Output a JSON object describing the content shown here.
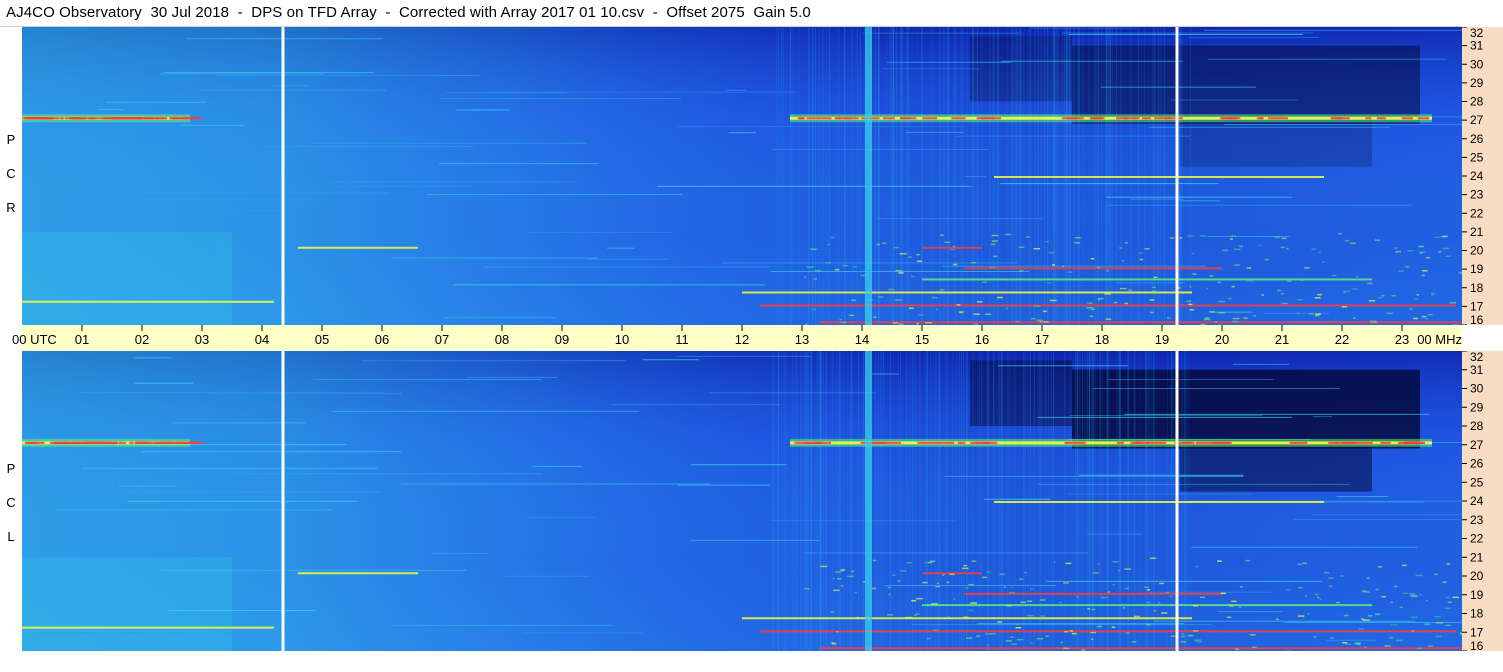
{
  "title": "AJ4CO Observatory  30 Jul 2018  -  DPS on TFD Array  -  Corrected with Array 2017 01 10.csv  -  Offset 2075  Gain 5.0",
  "colors": {
    "axis_band": "#ffffc8",
    "freq_band": "#f9dcc4",
    "deep_blue": "#0c1fa8",
    "mid_blue": "#1e55e0",
    "light_blue": "#2fa0f0",
    "cyan": "#38d0ec",
    "dark": "#050a40",
    "hot_red": "#ff3b3b",
    "hot_yellow": "#f4ff3a",
    "hot_green": "#58f080"
  },
  "chart_data": {
    "type": "heatmap",
    "x_axis": {
      "unit": "UTC",
      "range_hours": [
        0,
        24
      ],
      "tick_labels": [
        "00",
        "01",
        "02",
        "03",
        "04",
        "05",
        "06",
        "07",
        "08",
        "09",
        "10",
        "11",
        "12",
        "13",
        "14",
        "15",
        "16",
        "17",
        "18",
        "19",
        "20",
        "21",
        "22",
        "23",
        "00"
      ],
      "start_label": "00  UTC",
      "end_label": "00  MHz"
    },
    "y_axis": {
      "unit": "MHz",
      "range": [
        16,
        32
      ],
      "tick_labels": [
        "32",
        "31",
        "30",
        "29",
        "28",
        "27",
        "26",
        "25",
        "24",
        "23",
        "22",
        "21",
        "20",
        "19",
        "18",
        "17",
        "16"
      ]
    },
    "panels": [
      {
        "name": "R C P",
        "letters": [
          "R",
          "C",
          "P"
        ]
      },
      {
        "name": "L C P",
        "letters": [
          "L",
          "C",
          "P"
        ]
      }
    ],
    "gaps_utc_hours": [
      4.35,
      19.25
    ],
    "features": [
      {
        "label": "interference band",
        "freq_mhz": 27.1,
        "utc_hours": [
          0.0,
          2.8
        ]
      },
      {
        "label": "interference band",
        "freq_mhz": 27.1,
        "utc_hours": [
          12.8,
          23.5
        ]
      },
      {
        "label": "broadband column",
        "utc_hour": 14.1
      }
    ]
  }
}
